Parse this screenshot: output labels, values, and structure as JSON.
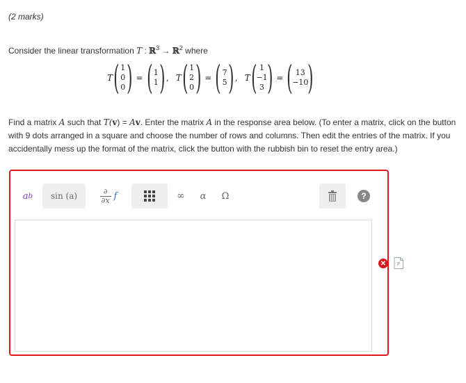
{
  "marks": "(2 marks)",
  "intro": {
    "prefix": "Consider the linear transformation",
    "symbol": "T",
    "colon": " : ",
    "domain": "ℝ",
    "domain_exp": "3",
    "arrow": " → ",
    "codomain": "ℝ",
    "codomain_exp": "2",
    "suffix": "where"
  },
  "equation": [
    {
      "input": [
        "1",
        "0",
        "0"
      ],
      "output": [
        "1",
        "1"
      ]
    },
    {
      "input": [
        "1",
        "2",
        "0"
      ],
      "output": [
        "7",
        "5"
      ]
    },
    {
      "input": [
        "1",
        "−1",
        "3"
      ],
      "output": [
        "13",
        "−10"
      ]
    }
  ],
  "find_text": {
    "p1": "Find a matrix ",
    "A1": "A",
    "p2": " such that ",
    "Tv": "T(",
    "v1": "v",
    "close": ") = ",
    "A2": "A",
    "v2": "v",
    "p3": ". Enter the matrix ",
    "A3": "A",
    "p4": " in the response area below. (To enter a matrix, click on the button with 9 dots arranged in a square and choose the number of rows and columns.  Then edit the entries of the matrix.  If you accidentally mess up the format of the matrix, click the button with the rubbish bin to reset the entry area.)"
  },
  "toolbar": {
    "sup_base": "a",
    "sup_exp": "b",
    "sin_label": "sin (a)",
    "partial_num": "∂",
    "partial_den": "∂x",
    "partial_f": "f",
    "infinity": "∞",
    "alpha": "α",
    "omega": "Ω",
    "help": "?"
  },
  "colors": {
    "error_border": "#e0181b",
    "error_icon": "#d9161a",
    "toolbar_button_bg": "#eeeeee",
    "help_bg": "#888888",
    "function_blue": "#3366cc",
    "superscript_purple": "#7b3fb3"
  },
  "icons": {
    "matrix": "nine-dots-matrix-icon",
    "trash": "rubbish-bin-icon",
    "help": "help-circle-icon",
    "error": "error-x-icon",
    "preview": "document-preview-icon"
  }
}
